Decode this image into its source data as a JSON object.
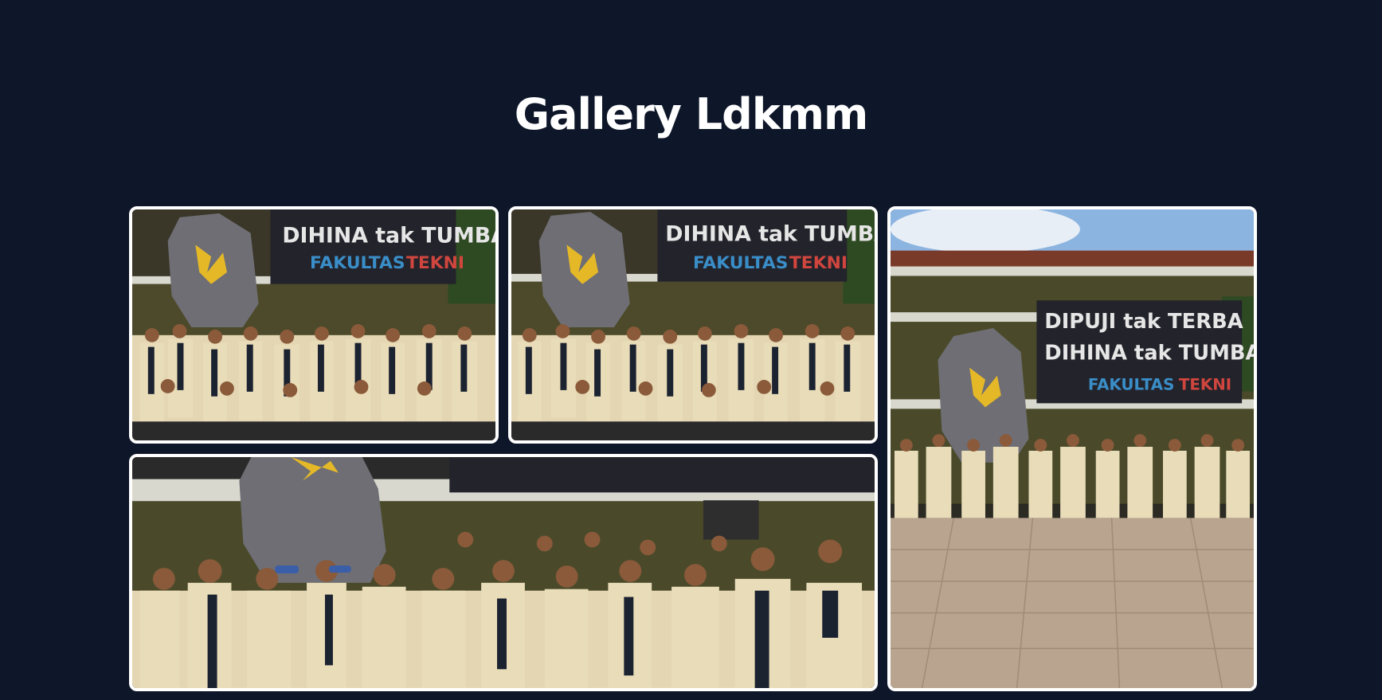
{
  "page": {
    "title": "Gallery Ldkmm",
    "background": "#0e1629"
  },
  "gallery": {
    "photos": [
      {
        "name": "group-photo-1",
        "banner_top": "DIHINA tak TUMBA",
        "banner_bottom_1": "FAKULTAS",
        "banner_bottom_2": "TEKNI"
      },
      {
        "name": "group-photo-2",
        "banner_top": "DIHINA tak TUMBA",
        "banner_bottom_1": "FAKULTAS",
        "banner_bottom_2": "TEKNI"
      },
      {
        "name": "group-photo-3",
        "banner_top": "DIPUJI tak TERBA",
        "banner_mid": "DIHINA tak TUMBA",
        "banner_bottom_1": "FAKULTAS",
        "banner_bottom_2": "TEKNI"
      },
      {
        "name": "group-photo-4"
      }
    ]
  },
  "colors": {
    "jacket": "#e9dcb8",
    "banner": "#23232b",
    "accent_blue": "#3a8ec8",
    "accent_red": "#d0463e"
  }
}
